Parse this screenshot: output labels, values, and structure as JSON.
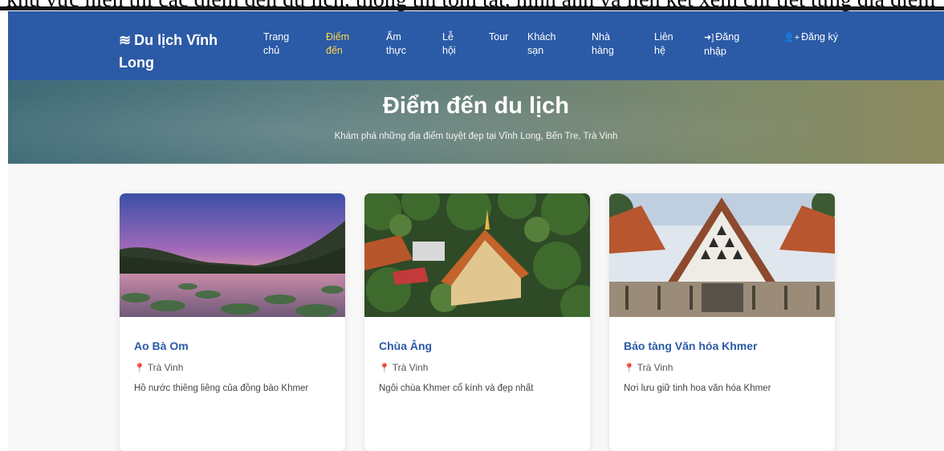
{
  "caption": {
    "text": "khu vực hiển thị các điểm đến du lịch, thông tin tóm tắt, hình ảnh và liên kết xem chi tiết từng địa điểm"
  },
  "navbar": {
    "brand": "Du lịch Vĩnh Long",
    "items": [
      {
        "label": "Trang chủ",
        "active": false
      },
      {
        "label": "Điểm đến",
        "active": true
      },
      {
        "label": "Ẩm thực",
        "active": false
      },
      {
        "label": "Lễ hội",
        "active": false
      },
      {
        "label": "Tour",
        "active": false
      },
      {
        "label": "Khách sạn",
        "active": false
      },
      {
        "label": "Nhà hàng",
        "active": false
      },
      {
        "label": "Liên hệ",
        "active": false
      },
      {
        "label": "Đăng nhập",
        "active": false,
        "icon": "sign-in-icon"
      },
      {
        "label": "Đăng ký",
        "active": false,
        "icon": "user-plus-icon"
      }
    ],
    "colors": {
      "background": "#2b5aa6",
      "active": "#ffd54a",
      "text": "#ffffff"
    }
  },
  "hero": {
    "title": "Điểm đến du lịch",
    "subtitle": "Khám phá những địa điểm tuyệt đẹp tại Vĩnh Long, Bến Tre, Trà Vinh"
  },
  "cards": [
    {
      "title": "Ao Bà Om",
      "location": "Trà Vinh",
      "description": "Hồ nước thiêng liêng của đồng bào Khmer",
      "image": "lake-sunset-photo"
    },
    {
      "title": "Chùa Âng",
      "location": "Trà Vinh",
      "description": "Ngôi chùa Khmer cổ kính và đẹp nhất",
      "image": "khmer-pagoda-photo"
    },
    {
      "title": "Bảo tàng Văn hóa Khmer",
      "location": "Trà Vinh",
      "description": "Nơi lưu giữ tinh hoa văn hóa Khmer",
      "image": "khmer-museum-photo"
    }
  ]
}
